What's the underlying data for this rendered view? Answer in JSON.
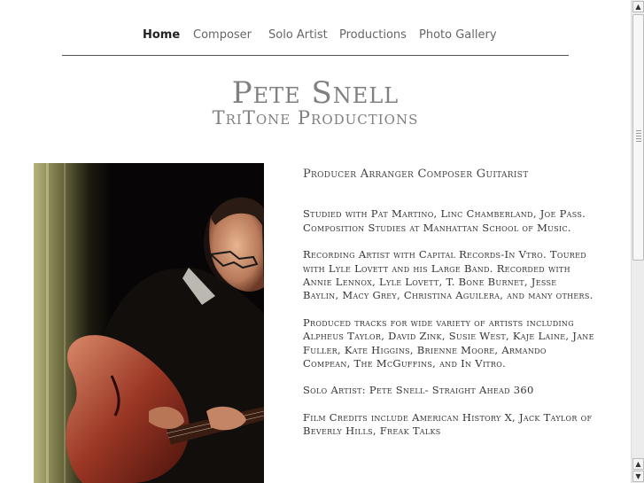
{
  "nav": {
    "items": [
      {
        "label": "Home",
        "active": true
      },
      {
        "label": "Composer",
        "active": false
      },
      {
        "label": "Solo Artist",
        "active": false
      },
      {
        "label": "Productions",
        "active": false
      },
      {
        "label": "Photo Gallery",
        "active": false
      }
    ]
  },
  "header": {
    "title": "Pete Snell",
    "subtitle": "TriTone Productions"
  },
  "bio": {
    "heading": "Producer Arranger Composer Guitarist",
    "paragraphs": [
      "Studied with Pat Martino, Linc Chamberland, Joe Pass. Composition Studies at Manhattan School of Music.",
      "Recording Artist with Capital Records-In Vtro. Toured with Lyle Lovett and his Large Band. Recorded with Annie Lennox, Lyle Lovett, T. Bone Burnet, Jesse Baylin, Macy Grey,  Christina Aguilera, and many others.",
      "Produced tracks for wide variety of artists including Alpheus Taylor, David Zink, Susie West, Kaje Laine, Jane Fuller, Kate Higgins, Brienne Moore, Armando Compean, The McGuffins, and In Vitro.",
      "Solo Artist: Pete Snell- Straight Ahead 360",
      "Film Credits include American History X, Jack Taylor of Beverly Hills, Freak Talks"
    ]
  },
  "photo": {
    "subject": "guitarist-photo"
  },
  "scrollbar": {
    "up_arrow": "▲",
    "down_arrow": "▼"
  }
}
